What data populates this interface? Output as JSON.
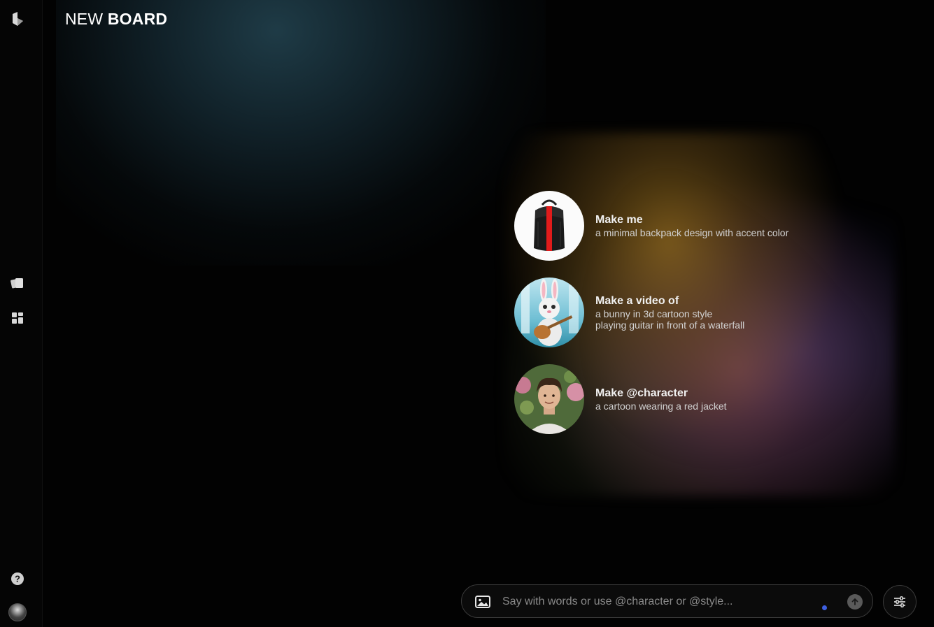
{
  "header": {
    "title_light": "NEW",
    "title_bold": "BOARD"
  },
  "sidebar": {
    "items": [
      {
        "icon": "logo-icon"
      },
      {
        "icon": "cards-icon"
      },
      {
        "icon": "grid-icon"
      },
      {
        "icon": "help-icon"
      },
      {
        "icon": "avatar"
      }
    ]
  },
  "suggestions": [
    {
      "heading": "Make me",
      "desc_lines": [
        "a minimal backpack design with accent color"
      ],
      "thumb": "backpack"
    },
    {
      "heading": "Make a video of",
      "desc_lines": [
        "a bunny in 3d cartoon style",
        "playing guitar in front of a waterfall"
      ],
      "thumb": "bunny"
    },
    {
      "heading": "Make @character",
      "desc_lines": [
        "a cartoon wearing a red jacket"
      ],
      "thumb": "person"
    }
  ],
  "prompt": {
    "placeholder": "Say with words or use @character or @style...",
    "value": ""
  },
  "colors": {
    "accent_dot": "#3d5fe0",
    "background": "#020202"
  }
}
